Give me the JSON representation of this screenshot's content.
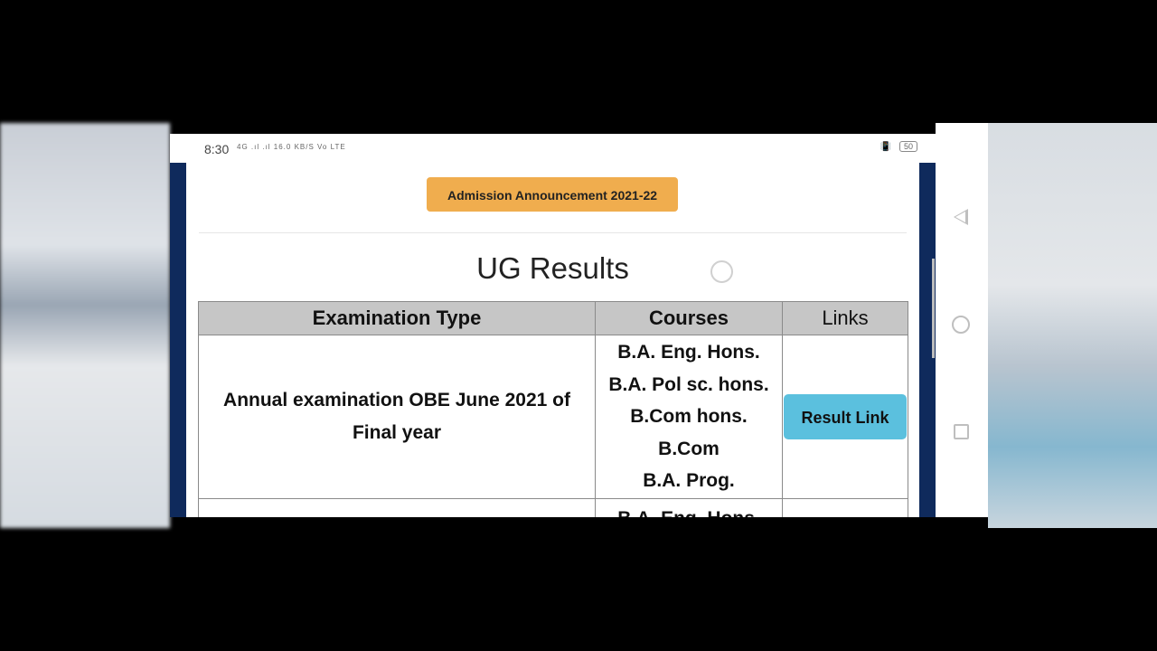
{
  "status": {
    "time": "8:30",
    "signal": "4G .ıl .ıl 16.0 KB/S Vo LTE",
    "battery": "50"
  },
  "announcement": {
    "label": "Admission Announcement 2021-22"
  },
  "page": {
    "title": "UG Results"
  },
  "table": {
    "headers": [
      "Examination Type",
      "Courses",
      "Links"
    ],
    "rows": [
      {
        "exam_type": "Annual examination OBE June 2021 of Final year",
        "courses": [
          "B.A. Eng. Hons.",
          "B.A. Pol sc. hons.",
          "B.Com hons.",
          "B.Com",
          "B.A. Prog."
        ],
        "link": "Result Link"
      },
      {
        "exam_type": "",
        "courses": [
          "B.A. Eng. Hons."
        ],
        "link": ""
      }
    ]
  },
  "colors": {
    "accent": "#f0ad4e",
    "button": "#5bc0de",
    "sidebar": "#0f2a5c",
    "header_bg": "#c6c6c6"
  }
}
